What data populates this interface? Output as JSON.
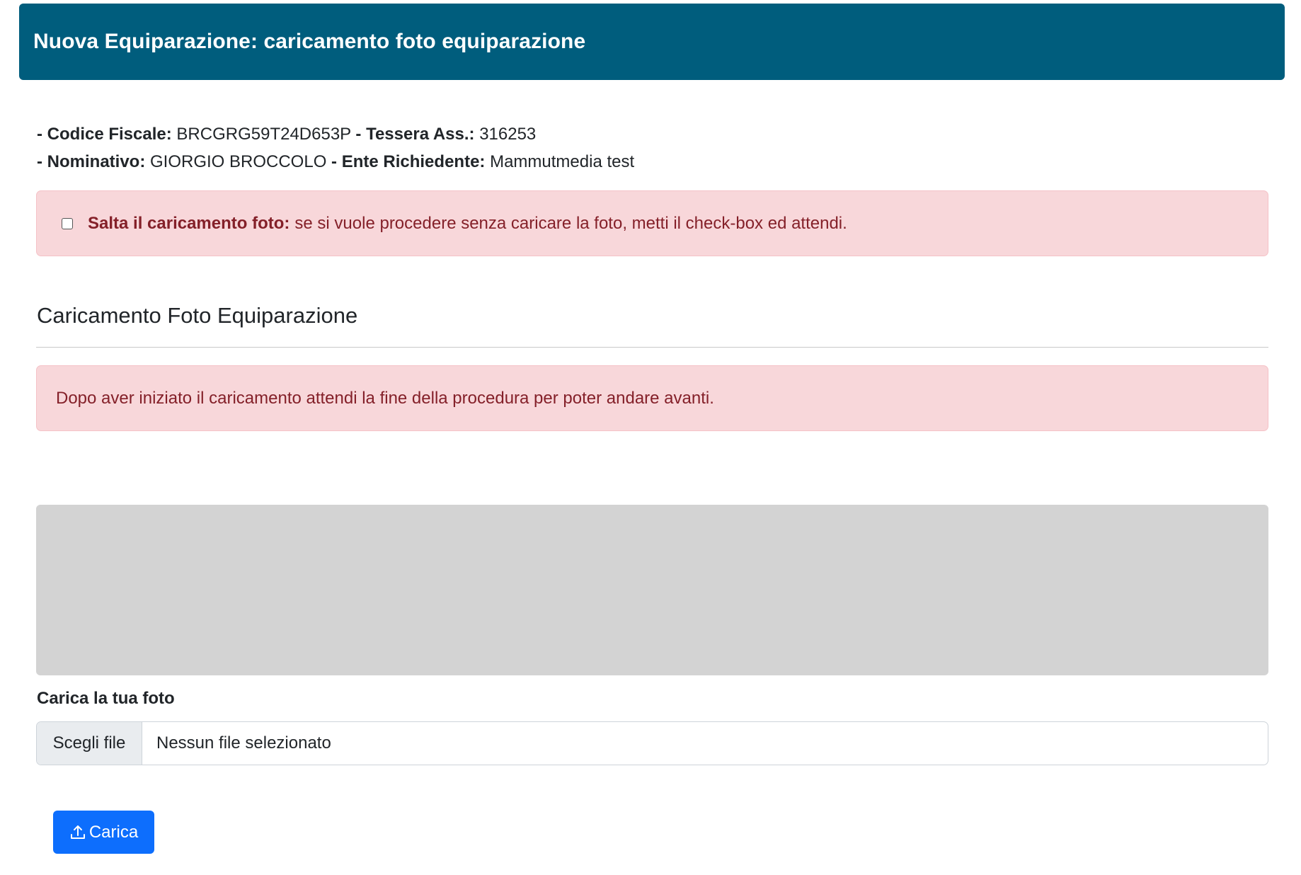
{
  "header": {
    "title": "Nuova Equiparazione: caricamento foto equiparazione"
  },
  "info": {
    "codice_fiscale_label": "- Codice Fiscale:",
    "codice_fiscale_value": "BRCGRG59T24D653P",
    "tessera_label": "- Tessera Ass.:",
    "tessera_value": "316253",
    "nominativo_label": "- Nominativo:",
    "nominativo_value": "GIORGIO BROCCOLO",
    "ente_label": "- Ente Richiedente:",
    "ente_value": "Mammutmedia test"
  },
  "skip_alert": {
    "bold_label": "Salta il caricamento foto:",
    "text": "se si vuole procedere senza caricare la foto, metti il check-box ed attendi.",
    "checked": false
  },
  "section": {
    "title": "Caricamento Foto Equiparazione"
  },
  "wait_alert": {
    "text": "Dopo aver iniziato il caricamento attendi la fine della procedura per poter andare avanti."
  },
  "upload": {
    "label": "Carica la tua foto",
    "choose_button": "Scegli file",
    "file_status": "Nessun file selezionato",
    "submit_label": "Carica",
    "submit_icon": "upload-icon"
  },
  "colors": {
    "header_bg": "#005d7d",
    "alert_bg": "#f8d7da",
    "alert_text": "#842029",
    "primary": "#0d6efd",
    "preview_bg": "#d3d3d3"
  }
}
